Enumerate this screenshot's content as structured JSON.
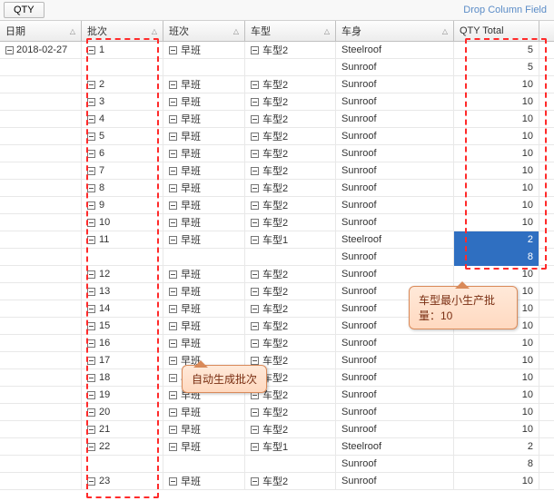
{
  "topbar": {
    "qty_btn": "QTY",
    "drop_hint": "Drop Column Field"
  },
  "headers": {
    "date": "日期",
    "batch": "批次",
    "shift": "班次",
    "cartype": "车型",
    "body": "车身",
    "qty_total": "QTY Total"
  },
  "date_value": "2018-02-27",
  "annotations": {
    "min_batch": "车型最小生产批量：10",
    "auto_gen": "自动生成批次"
  },
  "chart_data": {
    "type": "table",
    "columns": [
      "日期",
      "批次",
      "班次",
      "车型",
      "车身",
      "QTY Total"
    ],
    "rows": [
      {
        "date": "2018-02-27",
        "batch": "1",
        "shift": "早班",
        "cartype": "车型2",
        "body": "Steelroof",
        "qty": 5,
        "sel": false
      },
      {
        "date": "",
        "batch": "",
        "shift": "",
        "cartype": "",
        "body": "Sunroof",
        "qty": 5,
        "sel": false
      },
      {
        "date": "",
        "batch": "2",
        "shift": "早班",
        "cartype": "车型2",
        "body": "Sunroof",
        "qty": 10,
        "sel": false
      },
      {
        "date": "",
        "batch": "3",
        "shift": "早班",
        "cartype": "车型2",
        "body": "Sunroof",
        "qty": 10,
        "sel": false
      },
      {
        "date": "",
        "batch": "4",
        "shift": "早班",
        "cartype": "车型2",
        "body": "Sunroof",
        "qty": 10,
        "sel": false
      },
      {
        "date": "",
        "batch": "5",
        "shift": "早班",
        "cartype": "车型2",
        "body": "Sunroof",
        "qty": 10,
        "sel": false
      },
      {
        "date": "",
        "batch": "6",
        "shift": "早班",
        "cartype": "车型2",
        "body": "Sunroof",
        "qty": 10,
        "sel": false
      },
      {
        "date": "",
        "batch": "7",
        "shift": "早班",
        "cartype": "车型2",
        "body": "Sunroof",
        "qty": 10,
        "sel": false
      },
      {
        "date": "",
        "batch": "8",
        "shift": "早班",
        "cartype": "车型2",
        "body": "Sunroof",
        "qty": 10,
        "sel": false
      },
      {
        "date": "",
        "batch": "9",
        "shift": "早班",
        "cartype": "车型2",
        "body": "Sunroof",
        "qty": 10,
        "sel": false
      },
      {
        "date": "",
        "batch": "10",
        "shift": "早班",
        "cartype": "车型2",
        "body": "Sunroof",
        "qty": 10,
        "sel": false
      },
      {
        "date": "",
        "batch": "11",
        "shift": "早班",
        "cartype": "车型1",
        "body": "Steelroof",
        "qty": 2,
        "sel": true
      },
      {
        "date": "",
        "batch": "",
        "shift": "",
        "cartype": "",
        "body": "Sunroof",
        "qty": 8,
        "sel": true
      },
      {
        "date": "",
        "batch": "12",
        "shift": "早班",
        "cartype": "车型2",
        "body": "Sunroof",
        "qty": 10,
        "sel": false
      },
      {
        "date": "",
        "batch": "13",
        "shift": "早班",
        "cartype": "车型2",
        "body": "Sunroof",
        "qty": 10,
        "sel": false
      },
      {
        "date": "",
        "batch": "14",
        "shift": "早班",
        "cartype": "车型2",
        "body": "Sunroof",
        "qty": 10,
        "sel": false
      },
      {
        "date": "",
        "batch": "15",
        "shift": "早班",
        "cartype": "车型2",
        "body": "Sunroof",
        "qty": 10,
        "sel": false
      },
      {
        "date": "",
        "batch": "16",
        "shift": "早班",
        "cartype": "车型2",
        "body": "Sunroof",
        "qty": 10,
        "sel": false
      },
      {
        "date": "",
        "batch": "17",
        "shift": "早班",
        "cartype": "车型2",
        "body": "Sunroof",
        "qty": 10,
        "sel": false
      },
      {
        "date": "",
        "batch": "18",
        "shift": "早班",
        "cartype": "车型2",
        "body": "Sunroof",
        "qty": 10,
        "sel": false
      },
      {
        "date": "",
        "batch": "19",
        "shift": "早班",
        "cartype": "车型2",
        "body": "Sunroof",
        "qty": 10,
        "sel": false
      },
      {
        "date": "",
        "batch": "20",
        "shift": "早班",
        "cartype": "车型2",
        "body": "Sunroof",
        "qty": 10,
        "sel": false
      },
      {
        "date": "",
        "batch": "21",
        "shift": "早班",
        "cartype": "车型2",
        "body": "Sunroof",
        "qty": 10,
        "sel": false
      },
      {
        "date": "",
        "batch": "22",
        "shift": "早班",
        "cartype": "车型1",
        "body": "Steelroof",
        "qty": 2,
        "sel": false
      },
      {
        "date": "",
        "batch": "",
        "shift": "",
        "cartype": "",
        "body": "Sunroof",
        "qty": 8,
        "sel": false
      },
      {
        "date": "",
        "batch": "23",
        "shift": "早班",
        "cartype": "车型2",
        "body": "Sunroof",
        "qty": 10,
        "sel": false
      }
    ]
  }
}
